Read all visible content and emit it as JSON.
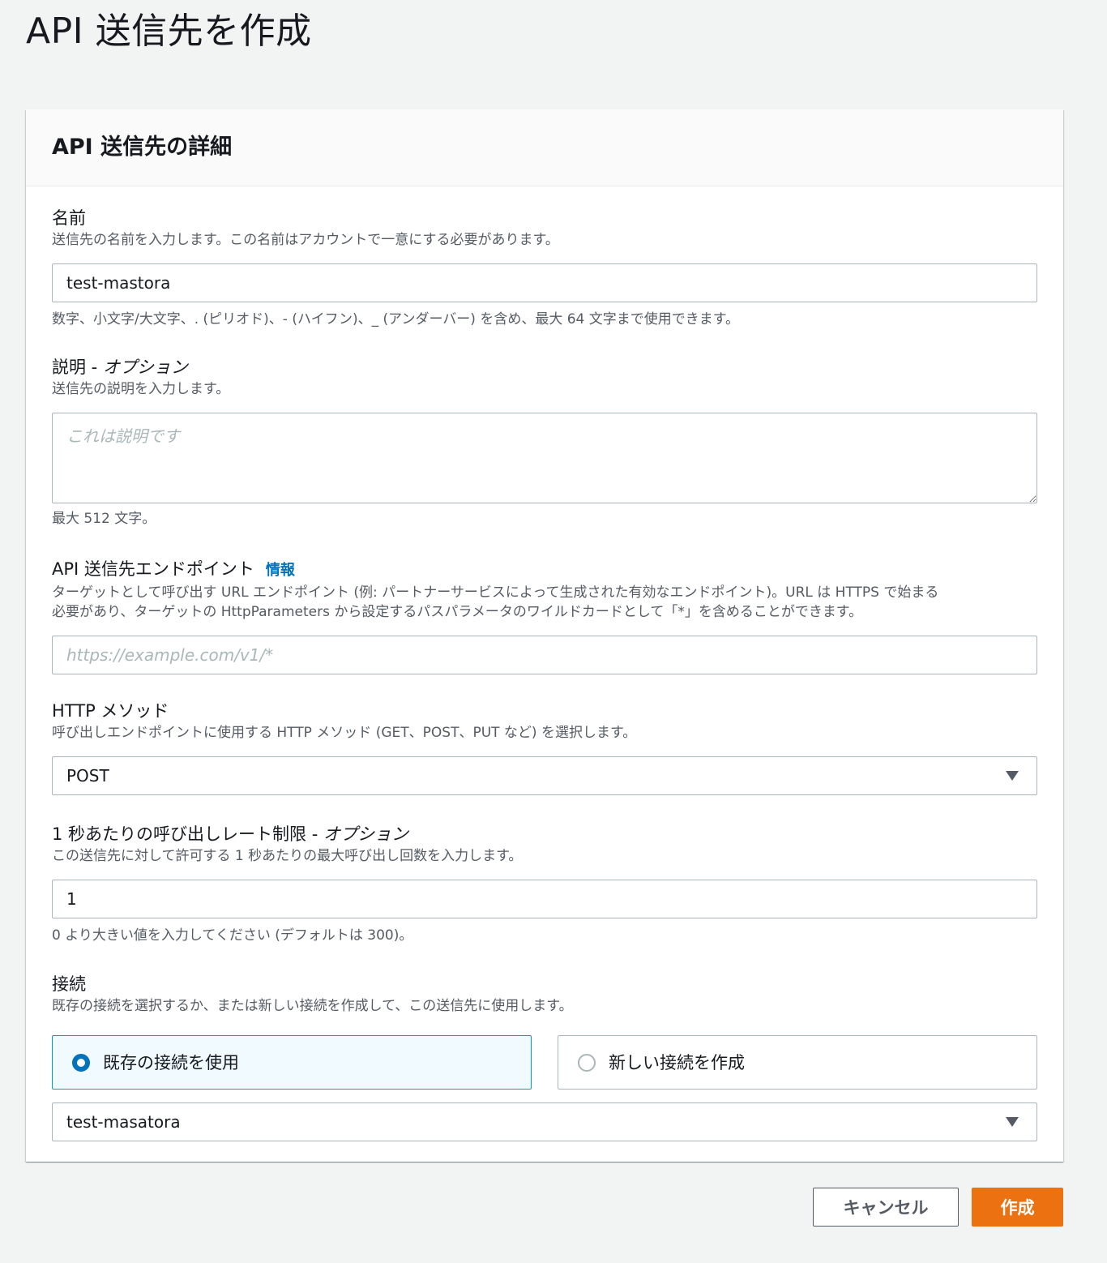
{
  "page": {
    "title": "API 送信先を作成"
  },
  "panel": {
    "title": "API 送信先の詳細"
  },
  "name_field": {
    "label": "名前",
    "description": "送信先の名前を入力します。この名前はアカウントで一意にする必要があります。",
    "value": "test-mastora",
    "hint": "数字、小文字/大文字、. (ピリオド)、- (ハイフン)、_ (アンダーバー) を含め、最大 64 文字まで使用できます。"
  },
  "description_field": {
    "label": "説明 - ",
    "label_optional": "オプション",
    "description": "送信先の説明を入力します。",
    "placeholder": "これは説明です",
    "value": "",
    "hint": "最大 512 文字。"
  },
  "endpoint_field": {
    "label": "API 送信先エンドポイント",
    "info_link": "情報",
    "description_line1": "ターゲットとして呼び出す URL エンドポイント (例: パートナーサービスによって生成された有効なエンドポイント)。URL は HTTPS で始まる",
    "description_line2": "必要があり、ターゲットの HttpParameters から設定するパスパラメータのワイルドカードとして「*」を含めることができます。",
    "placeholder": "https://example.com/v1/*",
    "value": ""
  },
  "http_method_field": {
    "label": "HTTP メソッド",
    "description": "呼び出しエンドポイントに使用する HTTP メソッド (GET、POST、PUT など) を選択します。",
    "selected": "POST",
    "caret_icon": "caret-down-icon"
  },
  "rate_limit_field": {
    "label": "1 秒あたりの呼び出しレート制限 - ",
    "label_optional": "オプション",
    "description": "この送信先に対して許可する 1 秒あたりの最大呼び出し回数を入力します。",
    "value": "1",
    "hint": "0 より大きい値を入力してください (デフォルトは 300)。"
  },
  "connection_field": {
    "label": "接続",
    "description": "既存の接続を選択するか、または新しい接続を作成して、この送信先に使用します。",
    "options": [
      {
        "label": "既存の接続を使用",
        "selected": true
      },
      {
        "label": "新しい接続を作成",
        "selected": false
      }
    ],
    "selected_connection": "test-masatora"
  },
  "actions": {
    "cancel_label": "キャンセル",
    "create_label": "作成"
  },
  "colors": {
    "background": "#f2f3f3",
    "primary_button": "#ec7211",
    "link": "#0073bb",
    "selected_tile_bg": "#f1faff",
    "selected_tile_border": "#00a1c9"
  }
}
